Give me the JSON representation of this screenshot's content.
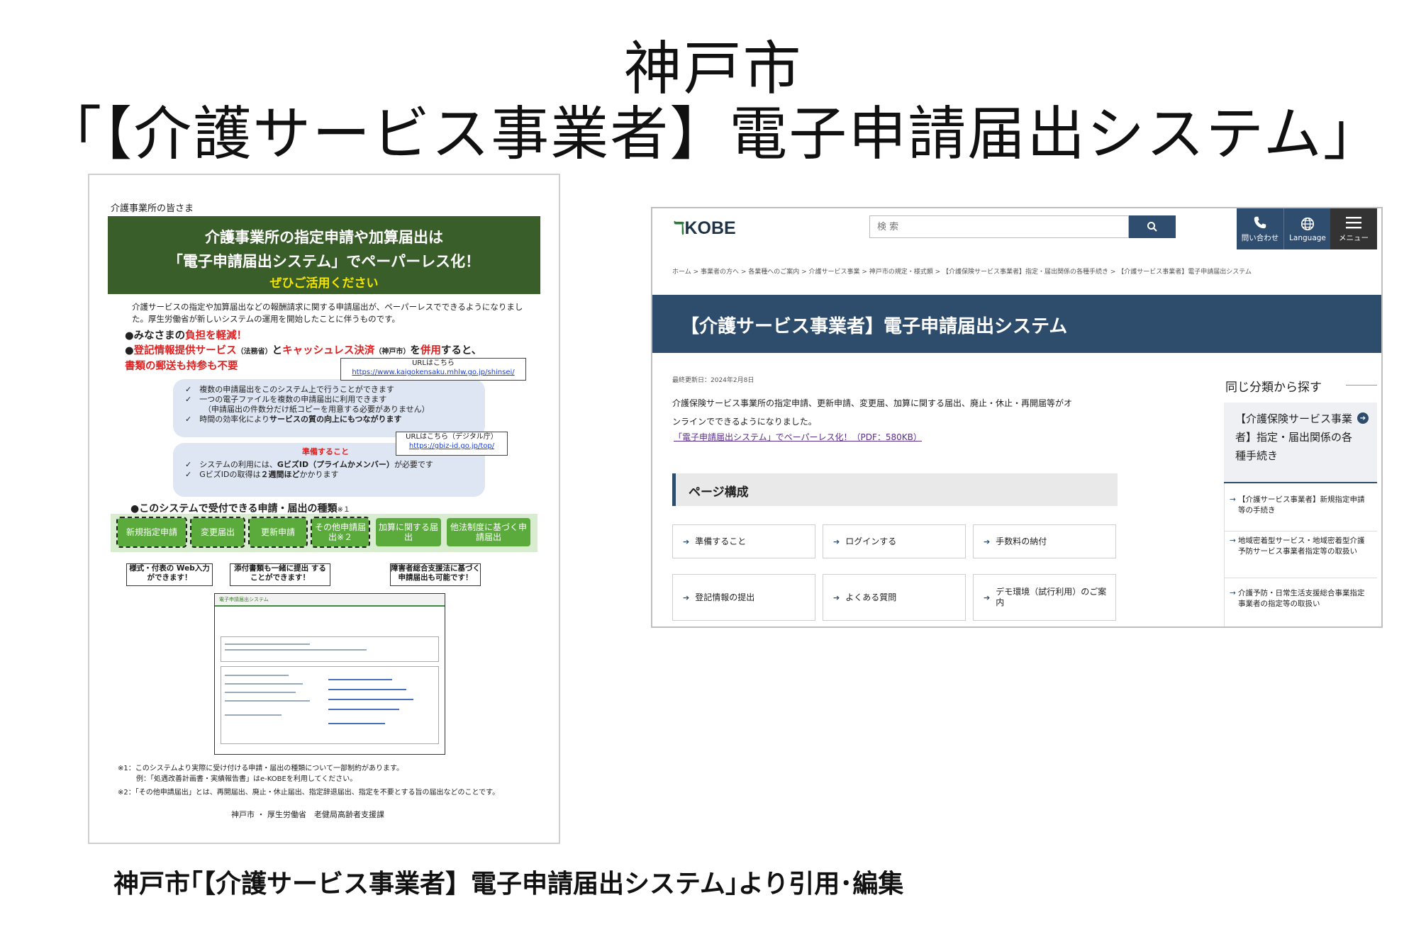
{
  "slide": {
    "title_line1": "神戸市",
    "title_line2": "「【介護サービス事業者】電子申請届出システム」",
    "caption": "神戸市｢【介護サービス事業者】電子申請届出システム｣より引用･編集"
  },
  "flyer": {
    "greeting": "介護事業所の皆さま",
    "banner_line1": "介護事業所の指定申請や加算届出は",
    "banner_line2": "「電子申請届出システム」でペーパーレス化！",
    "banner_line3": "ぜひご活用ください",
    "intro": "介護サービスの指定や加算届出などの報酬請求に関する申請届出が、ペーパーレスでできるようになりました。厚生労働省が新しいシステムの運用を開始したことに伴うものです。",
    "bullet1_a": "●みなさまの",
    "bullet1_b": "負担を軽減！",
    "bullet2_a": "●",
    "bullet2_b": "登記情報提供サービス",
    "bullet2_c": "（法務省）",
    "bullet2_d": "と",
    "bullet2_e": "キャッシュレス決済",
    "bullet2_f": "（神戸市）",
    "bullet2_g": "を",
    "bullet2_h": "併用",
    "bullet2_i": "すると、",
    "bullet2_j": "書類の郵送も持参も不要",
    "url1_label": "URLはこちら",
    "url1": "https://www.kaigokensaku.mhlw.go.jp/shinsei/",
    "check1": "✓　複数の申請届出をこのシステム上で行うことができます",
    "check2": "✓　一つの電子ファイルを複数の申請届出に利用できます",
    "check2_sub": "（申請届出の件数分だけ紙コピーを用意する必要がありません）",
    "check3_a": "✓　時間の効率化により",
    "check3_b": "サービスの質の向上にもつながります",
    "url2_label": "URLはこちら（デジタル庁）",
    "url2": "https://gbiz-id.go.jp/top/",
    "prep_label": "準備すること",
    "check4_a": "✓　システムの利用には、",
    "check4_b": "GビズID（プライムかメンバー）",
    "check4_c": "が必要です",
    "check5_a": "✓　GビズIDの取得は",
    "check5_b": "２週間ほど",
    "check5_c": "かかります",
    "types_heading": "●このシステムで受付できる申請・届出の種類",
    "types_note": "※１",
    "types": [
      "新規指定申請",
      "変更届出",
      "更新申請",
      "その他申請届出※２",
      "加算に関する届出",
      "他法制度に基づく申請届出"
    ],
    "callout1": "様式・付表の Web入力ができます！",
    "callout2": "添付書類も一緒に提出 することができます！",
    "callout3": "障害者総合支援法に基づく 申請届出も可能です！",
    "mini_title": "電子申請届出システム",
    "note1": "※1：このシステムより実際に受け付ける申請・届出の種類について一部制約があります。",
    "note1b": "例：「処遇改善計画書・実績報告書」はe-KOBEを利用してください。",
    "note2": "※2：「その他申請届出」とは、再開届出、廃止・休止届出、指定辞退届出、指定を不要とする旨の届出などのことです。",
    "footer": "神戸市 ・ 厚生労働省　老健局高齢者支援課"
  },
  "kobe": {
    "logo_text": "KOBE",
    "search_placeholder": "検 索",
    "header_buttons": [
      {
        "label": "問い合わせ",
        "icon": "phone-icon"
      },
      {
        "label": "Language",
        "icon": "globe-icon"
      },
      {
        "label": "メニュー",
        "icon": "menu-icon"
      }
    ],
    "breadcrumb": "ホーム > 事業者の方へ > 各業種へのご案内 > 介護サービス事業 > 神戸市の規定・様式類 > 【介護保険サービス事業者】指定・届出関係の各種手続き > 【介護サービス事業者】電子申請届出システム",
    "page_title": "【介護サービス事業者】電子申請届出システム",
    "updated": "最終更新日：2024年2月8日",
    "lead": "介護保険サービス事業所の指定申請、更新申請、変更届、加算に関する届出、廃止・休止・再開届等がオンラインでできるようになりました。",
    "pdf_link": "「電子申請届出システム」でペーパーレス化！（PDF：580KB）",
    "section_heading": "ページ構成",
    "nav_items": [
      "準備すること",
      "ログインする",
      "手数料の納付",
      "登記情報の提出",
      "よくある質問",
      "デモ環境（試行利用）のご案内"
    ],
    "side_heading": "同じ分類から探す",
    "side_box": "【介護保険サービス事業者】指定・届出関係の各種手続き",
    "side_items": [
      "【介護サービス事業者】新規指定申請等の手続き",
      "地域密着型サービス・地域密着型介護予防サービス事業者指定等の取扱い",
      "介護予防・日常生活支援総合事業指定事業者の指定等の取扱い"
    ]
  }
}
